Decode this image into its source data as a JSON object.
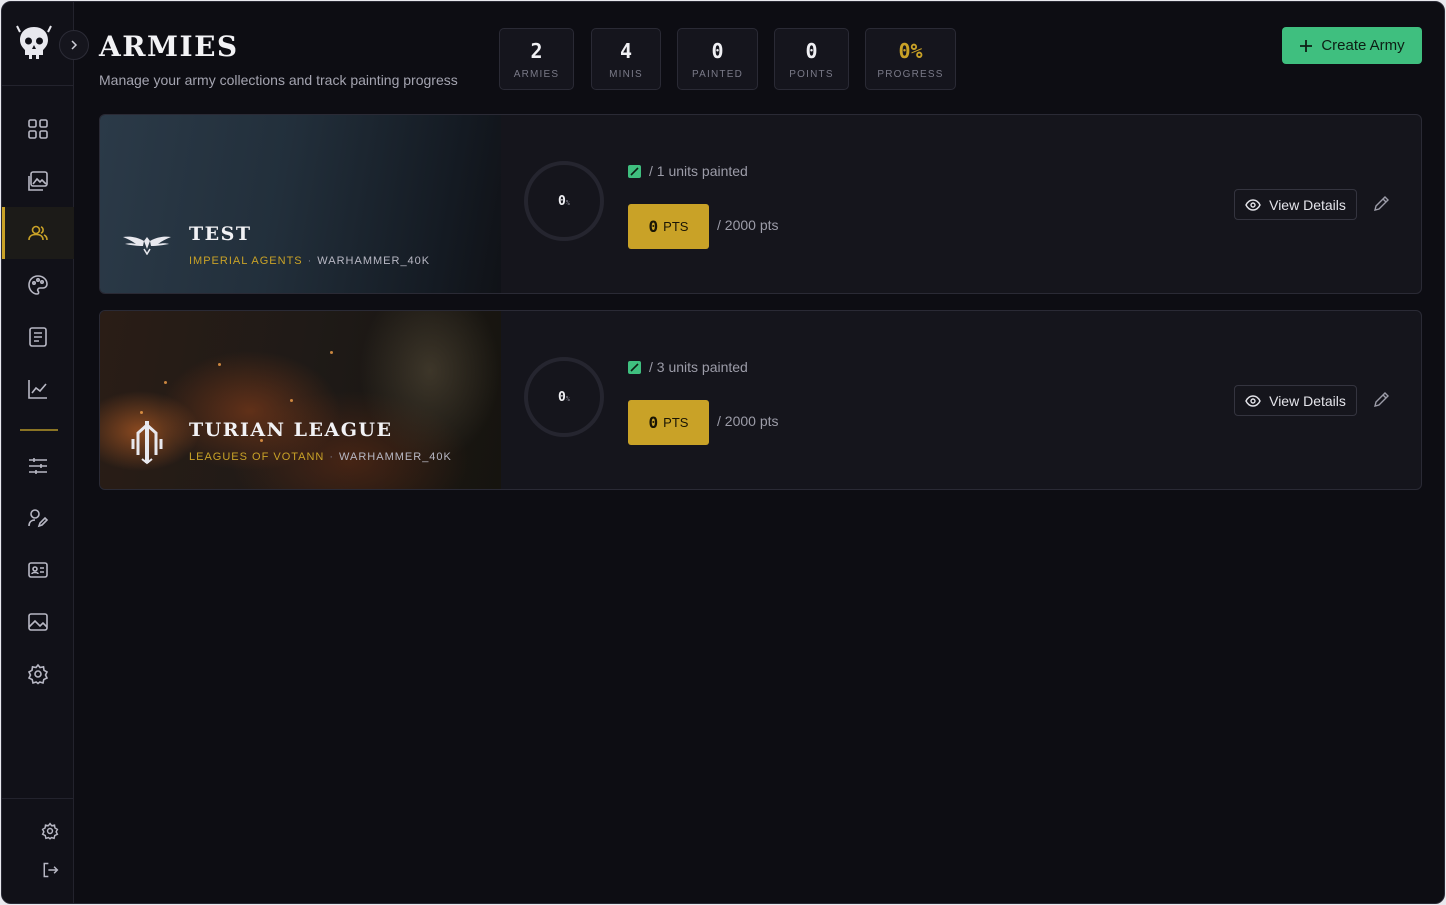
{
  "header": {
    "title": "ARMIES",
    "subtitle": "Manage your army collections and track painting progress",
    "create_button": "Create Army"
  },
  "stats": [
    {
      "value": "2",
      "label": "ARMIES"
    },
    {
      "value": "4",
      "label": "MINIS"
    },
    {
      "value": "0",
      "label": "PAINTED"
    },
    {
      "value": "0",
      "label": "POINTS"
    },
    {
      "value": "0%",
      "label": "PROGRESS"
    }
  ],
  "sidebar": {
    "items": [
      {
        "icon": "dashboard-grid-icon"
      },
      {
        "icon": "gallery-icon"
      },
      {
        "icon": "users-icon",
        "active": true
      },
      {
        "icon": "palette-icon"
      },
      {
        "icon": "notebook-icon"
      },
      {
        "icon": "chart-line-icon"
      },
      {
        "icon": "sliders-icon"
      },
      {
        "icon": "user-edit-icon"
      },
      {
        "icon": "id-card-icon"
      },
      {
        "icon": "image-icon"
      },
      {
        "icon": "gear-icon"
      }
    ],
    "bottom": [
      {
        "icon": "settings-icon"
      },
      {
        "icon": "logout-icon"
      }
    ]
  },
  "armies": [
    {
      "name": "TEST",
      "faction": "IMPERIAL AGENTS",
      "separator": "·",
      "system": "WARHAMMER_40K",
      "progress_pct": "0",
      "pct_symbol": "%",
      "units_painted_text": "/ 1 units painted",
      "points_value": "0",
      "points_unit": "PTS",
      "points_total_text": "/ 2000 pts",
      "view_label": "View Details"
    },
    {
      "name": "TURIAN LEAGUE",
      "faction": "LEAGUES OF VOTANN",
      "separator": "·",
      "system": "WARHAMMER_40K",
      "progress_pct": "0",
      "pct_symbol": "%",
      "units_painted_text": "/ 3 units painted",
      "points_value": "0",
      "points_unit": "PTS",
      "points_total_text": "/ 2000 pts",
      "view_label": "View Details"
    }
  ],
  "colors": {
    "accent_gold": "#c9a227",
    "accent_green": "#3fbf7f",
    "background": "#0d0d13",
    "card": "#15151c"
  }
}
